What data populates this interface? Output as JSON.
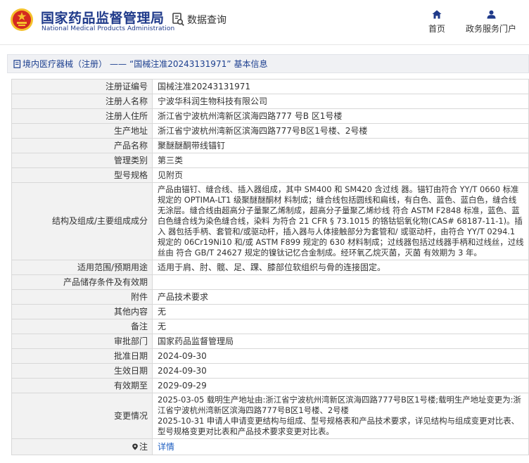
{
  "header": {
    "title_cn": "国家药品监督管理局",
    "title_en": "National Medical Products Administration",
    "search_label": "数据查询",
    "nav": [
      {
        "label": "首页",
        "icon": "home-icon"
      },
      {
        "label": "政务服务门户",
        "icon": "user-icon"
      }
    ]
  },
  "colors": {
    "brand": "#1f3a8a",
    "emblem_red": "#d42a1f",
    "emblem_gold": "#f5c12c",
    "link": "#1f5fc1"
  },
  "breadcrumb": {
    "category": "境内医疗器械（注册）",
    "separator": "——",
    "record": "“国械注准20243131971”",
    "suffix": "基本信息"
  },
  "rows": [
    {
      "label": "注册证编号",
      "value": "国械注准20243131971"
    },
    {
      "label": "注册人名称",
      "value": "宁波华科润生物科技有限公司"
    },
    {
      "label": "注册人住所",
      "value": "浙江省宁波杭州湾新区滨海四路777 号B 区1号楼"
    },
    {
      "label": "生产地址",
      "value": "浙江省宁波杭州湾新区滨海四路777号B区1号楼、2号楼"
    },
    {
      "label": "产品名称",
      "value": "聚醚醚酮带线锚钉"
    },
    {
      "label": "管理类别",
      "value": "第三类"
    },
    {
      "label": "型号规格",
      "value": "见附页"
    },
    {
      "label": "结构及组成/主要组成成分",
      "value": "产品由锚钉、缝合线、插入器组成，其中 SM400 和 SM420 含过线 器。锚钉由符合 YY/T 0660 标准规定的 OPTIMA-LT1 级聚醚醚酮材 料制成；缝合线包括圆线和扁线，有白色、蓝色、蓝白色，缝合线 无涂层。缝合线由超高分子量聚乙烯制成，超高分子量聚乙烯纱线 符合 ASTM F2848 标准，蓝色、蓝白色缝合线为染色缝合线，染料 为符合 21 CFR § 73.1015 的铬钴铝氧化物(CAS# 68187-11-1)。插入 器包括手柄、套管和/或驱动杆，插入器与人体接触部分为套管和/ 或驱动杆，由符合 YY/T 0294.1 规定的 06Cr19Ni10 和/或 ASTM F899 规定的 630 材料制成；过线器包括过线器手柄和过线丝，过线丝由 符合 GB/T 24627 规定的镍钛记忆合金制成。经环氧乙烷灭菌，灭菌 有效期为 3 年。"
    },
    {
      "label": "适用范围/预期用途",
      "value": "适用于肩、肘、髋、足、踝、膝部位软组织与骨的连接固定。"
    },
    {
      "label": "产品储存条件及有效期",
      "value": ""
    },
    {
      "label": "附件",
      "value": "产品技术要求"
    },
    {
      "label": "其他内容",
      "value": "无"
    },
    {
      "label": "备注",
      "value": "无"
    },
    {
      "label": "审批部门",
      "value": "国家药品监督管理局"
    },
    {
      "label": "批准日期",
      "value": "2024-09-30"
    },
    {
      "label": "生效日期",
      "value": "2024-09-30"
    },
    {
      "label": "有效期至",
      "value": "2029-09-29"
    },
    {
      "label": "变更情况",
      "value": "2025-03-05 载明生产地址由:浙江省宁波杭州湾新区滨海四路777号B区1号楼;载明生产地址变更为:浙江省宁波杭州湾新区滨海四路777号B区1号楼、2号楼\n2025-10-31 申请人申请变更结构与组成、型号规格表和产品技术要求，详见结构与组成变更对比表、型号规格变更对比表和产品技术要求变更对比表。"
    }
  ],
  "note": {
    "label": "注",
    "icon": "map-pin-icon",
    "value": "详情"
  }
}
